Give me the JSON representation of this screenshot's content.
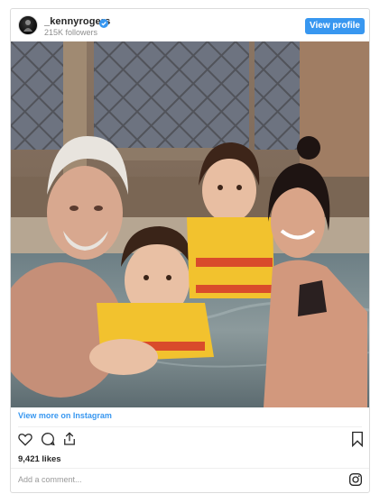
{
  "post": {
    "username": "_kennyrogers",
    "followers": "215K followers",
    "view_profile_label": "View profile",
    "view_more_label": "View more on Instagram",
    "likes": "9,421 likes",
    "comment_placeholder": "Add a comment...",
    "accent_color": "#3897f0"
  },
  "icons": {
    "avatar": "profile-avatar",
    "verified": "verified-badge-icon",
    "like": "heart-icon",
    "comment": "comment-bubble-icon",
    "share": "share-icon",
    "save": "bookmark-icon",
    "instagram": "instagram-logo-icon"
  }
}
